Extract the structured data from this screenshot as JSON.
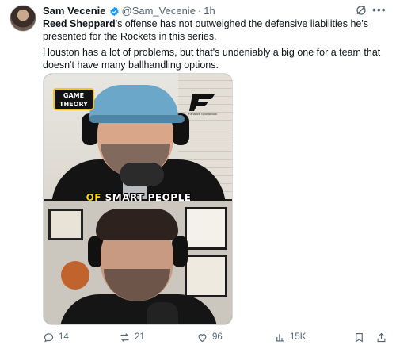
{
  "tweet": {
    "author_name": "Sam Vecenie",
    "handle": "@Sam_Vecenie",
    "separator": "·",
    "time": "1h",
    "verified": true,
    "paragraph1_bold": "Reed Sheppard",
    "paragraph1_rest": "'s offense has not outweighed the defensive liabilities he's presented for the Rockets in this series.",
    "paragraph2": "Houston has a lot of problems, but that's undeniably a big one for a team that doesn't have many ballhandling options."
  },
  "media": {
    "logo_left": "GAME THEORY",
    "logo_right_caption": "Fanatics Sportsbook",
    "caption_highlight": "OF",
    "caption_rest": " SMART PEOPLE"
  },
  "actions": {
    "replies": "14",
    "reposts": "21",
    "likes": "96",
    "views": "15K"
  },
  "colors": {
    "verified_blue": "#1d9bf0",
    "muted_text": "#536471",
    "caption_yellow": "#f7d500"
  },
  "icons": [
    "grok-icon",
    "more-icon",
    "verified-badge-icon",
    "reply-icon",
    "repost-icon",
    "like-icon",
    "views-icon",
    "bookmark-icon",
    "share-icon"
  ]
}
